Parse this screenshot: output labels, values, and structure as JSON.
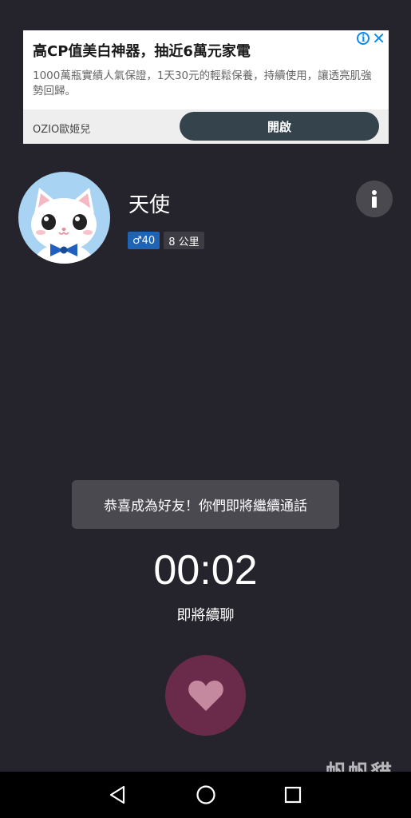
{
  "ad": {
    "title": "高CP值美白神器，抽近6萬元家電",
    "description": "1000萬瓶實績人氣保證，1天30元的輕鬆保養，持續使用，讓透亮肌強勢回歸。",
    "brand": "OZIO歐姬兒",
    "button_label": "開啟",
    "info_icon": "i",
    "close_icon": "✕"
  },
  "profile": {
    "name": "天使",
    "gender_tag": "♂40",
    "distance_tag": "8 公里"
  },
  "toast": {
    "message": "恭喜成為好友！你們即將繼續通話"
  },
  "call": {
    "timer": "00:02",
    "status": "即將續聊"
  },
  "watermark": "帆帆貓",
  "colors": {
    "background": "#25232b",
    "heart_button": "#6a2a4a",
    "gender_tag": "#1f63b4",
    "ad_button": "#35434c"
  }
}
